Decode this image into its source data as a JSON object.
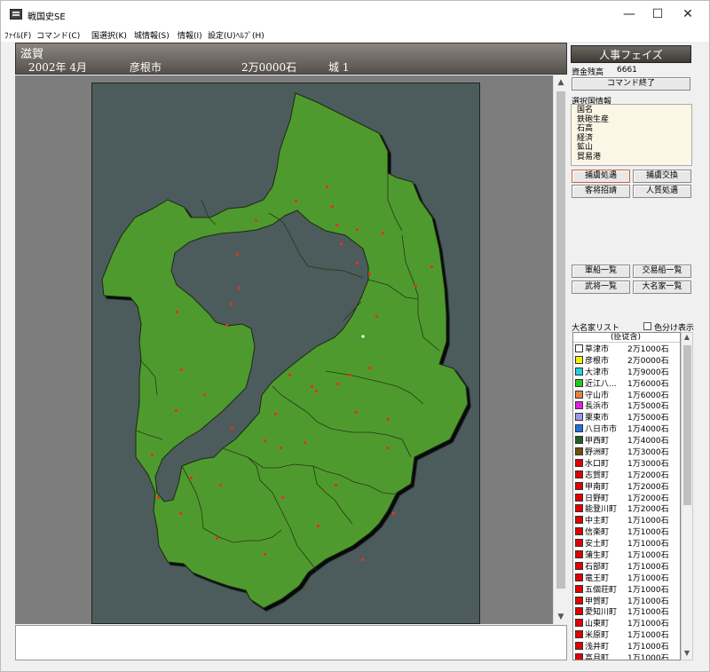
{
  "window": {
    "title": "戦国史SE",
    "min_glyph": "—",
    "max_glyph": "☐",
    "close_glyph": "✕"
  },
  "menu": [
    "ﾌｧｲﾙ(F)",
    "コマンド(C)",
    "国選択(K)",
    "城情報(S)",
    "情報(I)",
    "設定(U)",
    "ﾍﾙﾌﾟ(H)"
  ],
  "header": {
    "province": "滋賀",
    "date": "2002年 4月",
    "city": "彦根市",
    "koku": "2万0000石",
    "castle": "城 1"
  },
  "phase": "人事フェイズ",
  "funds": {
    "label": "資金残高",
    "value": "6661"
  },
  "end_command": "コマンド終了",
  "country_info": {
    "label": "選択国情報",
    "items": [
      "国名",
      "鉄砲生産",
      "石高",
      "経済",
      "鉱山",
      "貿易港"
    ]
  },
  "buttons": {
    "hostage_treatment": "捕虜処遇",
    "hostage_exchange": "捕虜交換",
    "recruit_guest": "客将招請",
    "hostage_placement": "人質処遇",
    "army_list": "軍船一覧",
    "trade_ship_list": "交易船一覧",
    "general_list": "武将一覧",
    "daimyo_list": "大名家一覧"
  },
  "daimyo_list": {
    "label": "大名家リスト",
    "color_toggle": "色分け表示",
    "header": "(臣従含)",
    "rows": [
      {
        "name": "草津市",
        "koku": "2万1000石",
        "color": "#ffffff"
      },
      {
        "name": "彦根市",
        "koku": "2万0000石",
        "color": "#f2f200"
      },
      {
        "name": "大津市",
        "koku": "1万9000石",
        "color": "#22d0e0"
      },
      {
        "name": "近江八...",
        "koku": "1万6000石",
        "color": "#22c822"
      },
      {
        "name": "守山市",
        "koku": "1万6000石",
        "color": "#e88040"
      },
      {
        "name": "長浜市",
        "koku": "1万5000石",
        "color": "#e020e0"
      },
      {
        "name": "栗東市",
        "koku": "1万5000石",
        "color": "#9898f0"
      },
      {
        "name": "八日市市",
        "koku": "1万4000石",
        "color": "#2070e0"
      },
      {
        "name": "甲西町",
        "koku": "1万4000石",
        "color": "#206020"
      },
      {
        "name": "野洲町",
        "koku": "1万3000石",
        "color": "#705010"
      },
      {
        "name": "水口町",
        "koku": "1万3000石",
        "color": "#e00000"
      },
      {
        "name": "志賀町",
        "koku": "1万2000石",
        "color": "#e00000"
      },
      {
        "name": "甲南町",
        "koku": "1万2000石",
        "color": "#e00000"
      },
      {
        "name": "日野町",
        "koku": "1万2000石",
        "color": "#e00000"
      },
      {
        "name": "能登川町",
        "koku": "1万2000石",
        "color": "#e00000"
      },
      {
        "name": "中主町",
        "koku": "1万1000石",
        "color": "#e00000"
      },
      {
        "name": "信楽町",
        "koku": "1万1000石",
        "color": "#e00000"
      },
      {
        "name": "安土町",
        "koku": "1万1000石",
        "color": "#e00000"
      },
      {
        "name": "蒲生町",
        "koku": "1万1000石",
        "color": "#e00000"
      },
      {
        "name": "石部町",
        "koku": "1万1000石",
        "color": "#e00000"
      },
      {
        "name": "竜王町",
        "koku": "1万1000石",
        "color": "#e00000"
      },
      {
        "name": "五個荘町",
        "koku": "1万1000石",
        "color": "#e00000"
      },
      {
        "name": "甲賀町",
        "koku": "1万1000石",
        "color": "#e00000"
      },
      {
        "name": "愛知川町",
        "koku": "1万1000石",
        "color": "#e00000"
      },
      {
        "name": "山東町",
        "koku": "1万1000石",
        "color": "#e00000"
      },
      {
        "name": "米原町",
        "koku": "1万1000石",
        "color": "#e00000"
      },
      {
        "name": "浅井町",
        "koku": "1万1000石",
        "color": "#e00000"
      },
      {
        "name": "高月町",
        "koku": "1万1000石",
        "color": "#e00000"
      }
    ]
  },
  "map": {
    "land_color": "#4f9a2e",
    "water_color": "#4c5c5c",
    "castle_color": "#e83020"
  }
}
